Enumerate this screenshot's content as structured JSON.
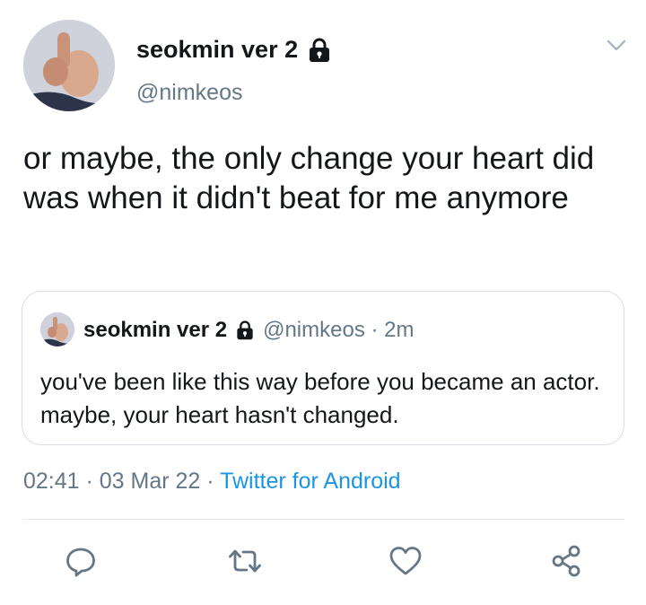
{
  "tweet": {
    "author": {
      "display_name": "seokmin ver 2",
      "handle": "@nimkeos"
    },
    "text": "or maybe, the only change your heart did was when it didn't beat for me anymore",
    "quoted": {
      "display_name": "seokmin ver 2",
      "handle": "@nimkeos",
      "meta": "@nimkeos · 2m",
      "time_ago": "2m",
      "text": "you've been like this way before you became an actor. maybe, your heart hasn't changed."
    },
    "time": "02:41",
    "date": "03 Mar 22",
    "timestamp_prefix": "02:41 · 03 Mar 22 · ",
    "source": "Twitter for Android"
  },
  "icons": {
    "lock": "lock-icon",
    "caret": "chevron-down-icon",
    "reply": "reply-icon",
    "retweet": "retweet-icon",
    "like": "heart-icon",
    "share": "share-icon"
  },
  "colors": {
    "text": "#14171a",
    "secondary": "#657786",
    "link": "#1b95e0",
    "border": "#d6dde3"
  }
}
